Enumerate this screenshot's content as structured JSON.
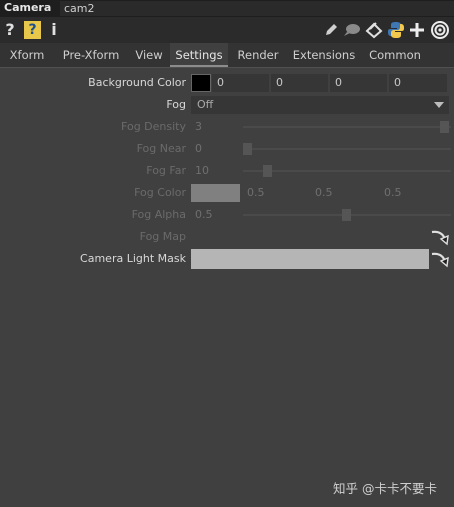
{
  "window": {
    "op_type": "Camera",
    "op_name": "cam2"
  },
  "toolbar": {
    "help_label": "?",
    "python_help_label": "?",
    "info_label": "i",
    "icons": [
      "help-icon",
      "python-help-icon",
      "info-icon",
      "edit-icon",
      "comment-icon",
      "clone-icon",
      "python-icon",
      "add-icon",
      "target-icon"
    ]
  },
  "tabs": [
    {
      "label": "Xform",
      "active": false
    },
    {
      "label": "Pre-Xform",
      "active": false
    },
    {
      "label": "View",
      "active": false
    },
    {
      "label": "Settings",
      "active": true
    },
    {
      "label": "Render",
      "active": false
    },
    {
      "label": "Extensions",
      "active": false
    },
    {
      "label": "Common",
      "active": false
    }
  ],
  "params": {
    "background_color": {
      "label": "Background Color",
      "swatch": "#000000",
      "values": [
        "0",
        "0",
        "0",
        "0"
      ]
    },
    "fog": {
      "label": "Fog",
      "value": "Off"
    },
    "fog_density": {
      "label": "Fog Density",
      "value": "3",
      "slider_fraction": 1.0
    },
    "fog_near": {
      "label": "Fog Near",
      "value": "0",
      "slider_fraction": 0.0
    },
    "fog_far": {
      "label": "Fog Far",
      "value": "10",
      "slider_fraction": 0.1
    },
    "fog_color": {
      "label": "Fog Color",
      "swatch": "#808080",
      "values": [
        "0.5",
        "0.5",
        "0.5"
      ]
    },
    "fog_alpha": {
      "label": "Fog Alpha",
      "value": "0.5",
      "slider_fraction": 0.5
    },
    "fog_map": {
      "label": "Fog Map",
      "value": ""
    },
    "camera_light_mask": {
      "label": "Camera Light Mask",
      "value": ""
    }
  },
  "watermark": "知乎 @卡卡不要卡",
  "colors": {
    "panel": "#404040",
    "titlebar": "#1e1e1e",
    "disabled_label": "#6a6a6a",
    "enabled_label": "#d8d8d8"
  }
}
